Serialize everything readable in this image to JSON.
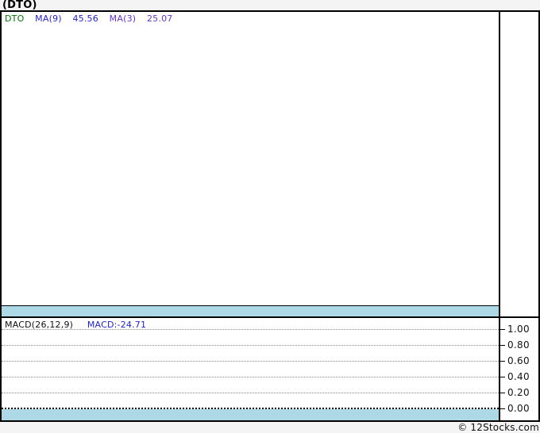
{
  "title": "(DTO)",
  "footer": {
    "credit": "© 12Stocks.com"
  },
  "colors": {
    "page_bg": "#f4f4f4",
    "band": "#add8e6",
    "ticker_green": "#007700",
    "ma9_blue": "#2222cc",
    "ma3_purple": "#6633cc",
    "macd_value_blue": "#2222cc",
    "grid_gray": "#888888",
    "border_black": "#000000"
  },
  "price_pane": {
    "legend": {
      "ticker": "DTO",
      "ma9_label": "MA(9)",
      "ma9_value": "45.56",
      "ma3_label": "MA(3)",
      "ma3_value": "25.07"
    }
  },
  "macd_pane": {
    "label": "MACD(26,12,9)",
    "value": "MACD:-24.71",
    "y_ticks": [
      "1.00",
      "0.80",
      "0.60",
      "0.40",
      "0.20",
      "0.00"
    ]
  },
  "chart_data": [
    {
      "type": "line",
      "title": "(DTO) price pane",
      "series": [
        {
          "name": "DTO",
          "color": "#007700",
          "values": []
        },
        {
          "name": "MA(9)",
          "color": "#2222cc",
          "last_value": 45.56,
          "values": []
        },
        {
          "name": "MA(3)",
          "color": "#6633cc",
          "last_value": 25.07,
          "values": []
        }
      ],
      "legend_position": "top-left",
      "note": "price pane is rendered empty - no plotted points visible"
    },
    {
      "type": "line",
      "title": "MACD(26,12,9)",
      "series": [
        {
          "name": "MACD",
          "last_value": -24.71,
          "values": []
        }
      ],
      "y_ticks": [
        1.0,
        0.8,
        0.6,
        0.4,
        0.2,
        0.0
      ],
      "ylim": [
        0.0,
        1.08
      ],
      "grid": true,
      "legend_position": "top-left",
      "note": "pane shows dotted gridlines only; current MACD value is below displayed axis range"
    }
  ]
}
